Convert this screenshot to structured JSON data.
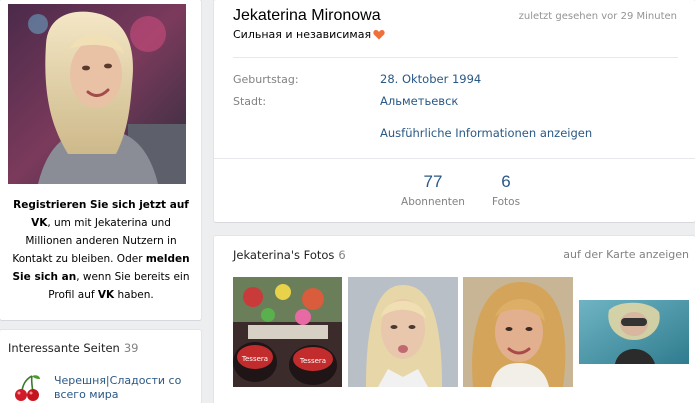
{
  "profile": {
    "name": "Jekaterina Mironowa",
    "last_seen": "zuletzt gesehen vor 29 Minuten",
    "status": "Сильная и независимая",
    "birthday_label": "Geburtstag:",
    "birthday_value": "28. Oktober 1994",
    "city_label": "Stadt:",
    "city_value": "Альметьевск",
    "more_info": "Ausführliche Informationen anzeigen"
  },
  "counters": [
    {
      "value": "77",
      "label": "Abonnenten"
    },
    {
      "value": "6",
      "label": "Fotos"
    }
  ],
  "registration": {
    "link_register": "Registrieren Sie sich jetzt auf VK",
    "text_1": ", um mit Jekaterina und Millionen anderen Nutzern in Kontakt zu bleiben. Oder ",
    "link_login": "melden Sie sich an",
    "text_2": ", wenn Sie bereits ein Profil auf ",
    "vk": "VK",
    "text_3": " haben."
  },
  "interesting_pages": {
    "title": "Interessante Seiten",
    "count": "39",
    "items": [
      {
        "label": "Черешня|Сладости со всего мира"
      }
    ]
  },
  "photos": {
    "title": "Jekaterina's Fotos",
    "count": "6",
    "map_link": "auf der Karte anzeigen",
    "items": [
      {
        "label": "Tessera"
      },
      {
        "label": "Tessera"
      }
    ]
  },
  "colors": {
    "link": "#2a5885",
    "muted": "#828282",
    "background": "#edeef0",
    "heart": "#f0703a"
  },
  "icons": {
    "heart": "heart-icon",
    "cherry": "cherry-icon"
  }
}
